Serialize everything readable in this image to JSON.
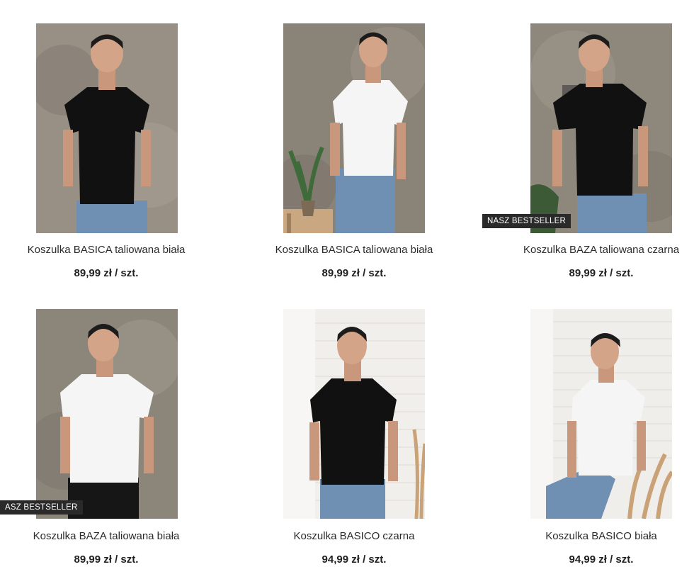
{
  "products": [
    {
      "name": "Koszulka BASICA taliowana biała",
      "price": "89,99 zł / szt.",
      "badge": "",
      "shirt": "#111111",
      "background": "concrete"
    },
    {
      "name": "Koszulka BASICA taliowana biała",
      "price": "89,99 zł / szt.",
      "badge": "",
      "shirt": "#f5f5f5",
      "background": "concrete"
    },
    {
      "name": "Koszulka BAZA taliowana czarna",
      "price": "89,99 zł / szt.",
      "badge": "NASZ BESTSELLER",
      "shirt": "#111111",
      "background": "concrete"
    },
    {
      "name": "Koszulka BAZA taliowana biała",
      "price": "89,99 zł / szt.",
      "badge": "ASZ BESTSELLER",
      "shirt": "#f5f5f5",
      "background": "concrete"
    },
    {
      "name": "Koszulka BASICO czarna",
      "price": "94,99 zł / szt.",
      "badge": "",
      "shirt": "#111111",
      "background": "brick"
    },
    {
      "name": "Koszulka BASICO biała",
      "price": "94,99 zł / szt.",
      "badge": "",
      "shirt": "#f5f5f5",
      "background": "brick"
    }
  ],
  "colors": {
    "badge_bg": "#2a2a2a",
    "text": "#2b2b2b"
  }
}
